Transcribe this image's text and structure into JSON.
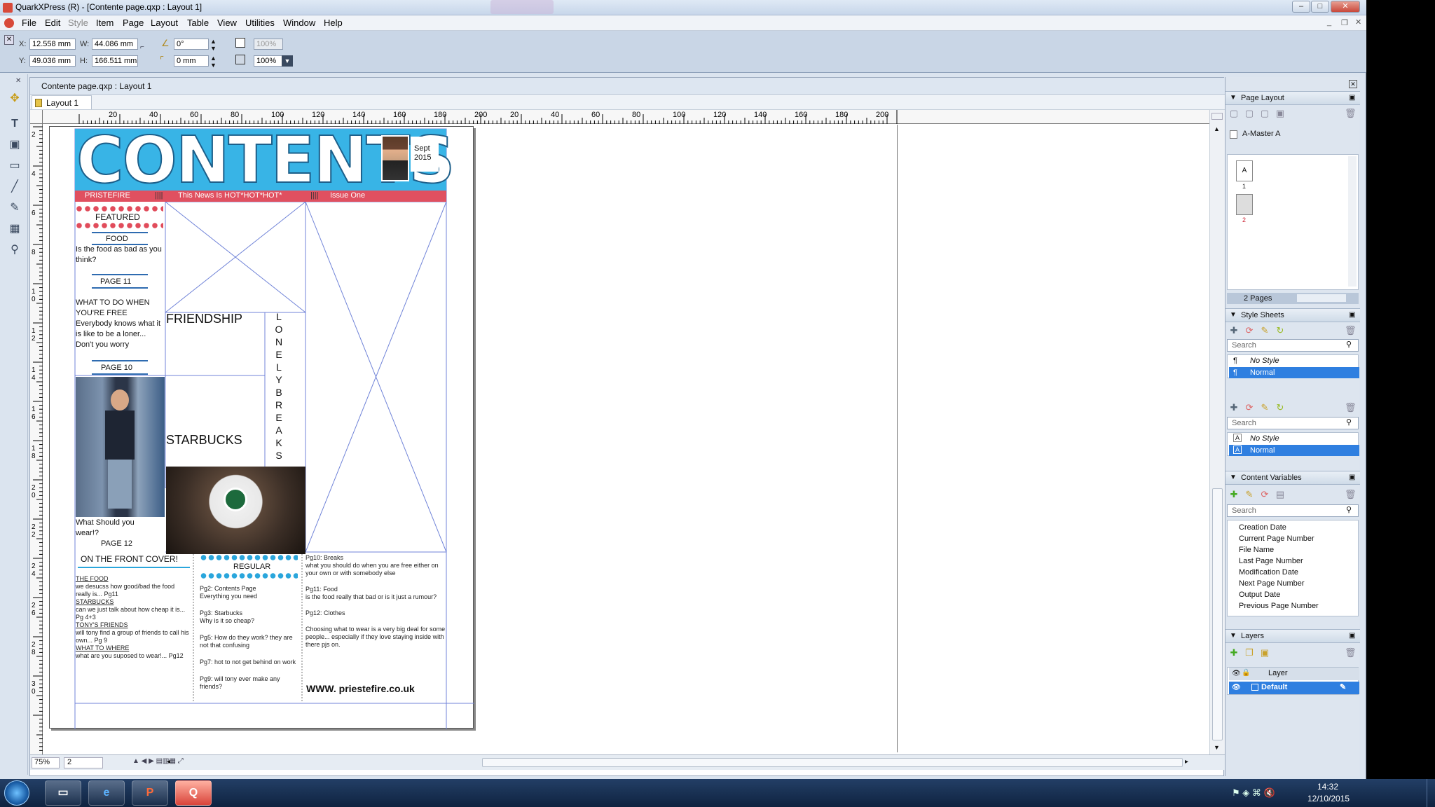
{
  "window": {
    "title": "QuarkXPress (R) - [Contente page.qxp : Layout 1]"
  },
  "menu": [
    "File",
    "Edit",
    "Style",
    "Item",
    "Page",
    "Layout",
    "Table",
    "View",
    "Utilities",
    "Window",
    "Help"
  ],
  "measure": {
    "x_label": "X:",
    "x": "12.558 mm",
    "y_label": "Y:",
    "y": "49.036 mm",
    "w_label": "W:",
    "w": "44.086 mm",
    "h_label": "H:",
    "h": "166.511 mm",
    "angle": "0°",
    "corner": "0 mm",
    "opacity1": "100%",
    "opacity2": "100%"
  },
  "document": {
    "title": "Contente page.qxp : Layout 1",
    "tab": "Layout 1",
    "ruler_numbers_top": [
      "20",
      "40",
      "60",
      "80",
      "100",
      "120",
      "140",
      "160",
      "180",
      "200",
      "20",
      "40",
      "60",
      "80",
      "100",
      "120",
      "140",
      "160",
      "180",
      "200"
    ],
    "ruler_numbers_left": [
      "2",
      "4",
      "6",
      "8",
      "1\n0",
      "1\n2",
      "1\n4",
      "1\n6",
      "1\n8",
      "2\n0",
      "2\n2",
      "2\n4",
      "2\n6",
      "2\n8",
      "3\n0"
    ],
    "zoom": "75%",
    "page_number": "2"
  },
  "page": {
    "masthead": "CONTENTS",
    "date": "Sept\n2015",
    "strip": {
      "left": "PRISTEFIRE",
      "sep1": "||||",
      "middle": "This News Is HOT*HOT*HOT*",
      "sep2": "||||",
      "right": "Issue One"
    },
    "featured": "FEATURED",
    "food": "FOOD",
    "food_text": "Is the food as bad as you think?",
    "page11": "PAGE 11",
    "free_title": "WHAT TO DO WHEN YOU'RE FREE",
    "free_text": "Everybody knows what it is like to be a loner... Don't you worry",
    "page10": "PAGE 10",
    "wear_text": "What Should you wear!?",
    "page12": "PAGE 12",
    "friendship": "FRIENDSHIP",
    "starbucks": "STARBUCKS",
    "vertical": [
      "L",
      "O",
      "N",
      "E",
      "L",
      "Y",
      "B",
      "R",
      "E",
      "A",
      "K",
      "S"
    ],
    "cover_title": "ON THE  FRONT COVER!",
    "cover_items": [
      {
        "head": "THE FOOD",
        "text": "we desucss how good/bad the food really is... Pg11"
      },
      {
        "head": "STARBUCKS",
        "text": "can we just talk about how cheap it is... Pg 4+3"
      },
      {
        "head": "TONY'S FRIENDS",
        "text": "will tony find a group of friends to call his own... Pg 9"
      },
      {
        "head": "WHAT TO WHERE",
        "text": "what are you suposed to wear!... Pg12"
      }
    ],
    "regular": "REGULAR",
    "regular_items": [
      "Pg2: Contents Page\nEverything you need",
      "Pg3: Starbucks\nWhy is it so cheap?",
      "Pg5: How do they work? they are not that confusing",
      "Pg7: hot to not get behind on work",
      "Pg9: will tony ever make any friends?"
    ],
    "right_items": [
      "Pg10: Breaks\nwhat you should do when you are free either on your own or with somebody else",
      "Pg11: Food\n is the food really that bad or is it just a rumour?",
      "Pg12: Clothes",
      "Choosing what to wear is a very big deal for some people... especially if they love staying inside with there pjs on."
    ],
    "website": "WWW. priestefire.co.uk"
  },
  "palettes": {
    "page_layout": {
      "title": "Page Layout",
      "master": "A-Master A",
      "page1_label": "A",
      "page1_num": "1",
      "page2_num": "2",
      "pages_count": "2 Pages"
    },
    "style_sheets": {
      "title": "Style Sheets",
      "search": "Search",
      "para_items": [
        "No Style",
        "Normal"
      ],
      "char_items": [
        "No Style",
        "Normal"
      ]
    },
    "content_variables": {
      "title": "Content Variables",
      "search": "Search",
      "items": [
        "Creation Date",
        "Current Page Number",
        "File Name",
        "Last Page Number",
        "Modification Date",
        "Next Page Number",
        "Output Date",
        "Previous Page Number"
      ]
    },
    "layers": {
      "title": "Layers",
      "header": "Layer",
      "items": [
        "Default"
      ]
    }
  },
  "taskbar": {
    "time": "14:32",
    "date": "12/10/2015"
  },
  "colors": {
    "masthead_bg": "#38b4e6",
    "strip": "#e05060",
    "selection": "#2f7fe0"
  }
}
